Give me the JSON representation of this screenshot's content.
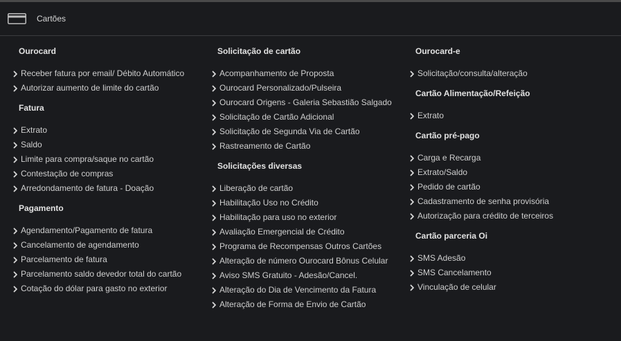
{
  "header": {
    "title": "Cartões",
    "icon": "credit-card-icon"
  },
  "colors": {
    "background": "#1a1b1e",
    "text": "#cfcfcf",
    "heading": "#e2e2e2"
  },
  "columns": [
    {
      "sections": [
        {
          "title": "Ourocard",
          "items": [
            "Receber fatura por email/ Débito Automático",
            "Autorizar aumento de limite do cartão"
          ]
        },
        {
          "title": "Fatura",
          "items": [
            "Extrato",
            "Saldo",
            "Limite para compra/saque no cartão",
            "Contestação de compras",
            "Arredondamento de fatura - Doação"
          ]
        },
        {
          "title": "Pagamento",
          "items": [
            "Agendamento/Pagamento de fatura",
            "Cancelamento de agendamento",
            "Parcelamento de fatura",
            "Parcelamento saldo devedor total do cartão",
            "Cotação do dólar para gasto no exterior"
          ]
        }
      ]
    },
    {
      "sections": [
        {
          "title": "Solicitação de cartão",
          "items": [
            "Acompanhamento de Proposta",
            "Ourocard Personalizado/Pulseira",
            "Ourocard Origens - Galeria Sebastião Salgado",
            "Solicitação de Cartão Adicional",
            "Solicitação de Segunda Via de Cartão",
            "Rastreamento de Cartão"
          ]
        },
        {
          "title": "Solicitações diversas",
          "items": [
            "Liberação de cartão",
            "Habilitação Uso no Crédito",
            "Habilitação para uso no exterior",
            "Avaliação Emergencial de Crédito",
            "Programa de Recompensas Outros Cartões",
            "Alteração de número Ourocard Bônus Celular",
            "Aviso SMS Gratuito - Adesão/Cancel.",
            "Alteração do Dia de Vencimento da Fatura",
            "Alteração de Forma de Envio de Cartão"
          ]
        }
      ]
    },
    {
      "sections": [
        {
          "title": "Ourocard-e",
          "items": [
            "Solicitação/consulta/alteração"
          ]
        },
        {
          "title": "Cartão Alimentação/Refeição",
          "items": [
            "Extrato"
          ]
        },
        {
          "title": "Cartão pré-pago",
          "items": [
            "Carga e Recarga",
            "Extrato/Saldo",
            "Pedido de cartão",
            "Cadastramento de senha provisória",
            "Autorização para crédito de terceiros"
          ]
        },
        {
          "title": "Cartão parceria Oi",
          "items": [
            "SMS Adesão",
            "SMS Cancelamento",
            "Vinculação de celular"
          ]
        }
      ]
    }
  ]
}
